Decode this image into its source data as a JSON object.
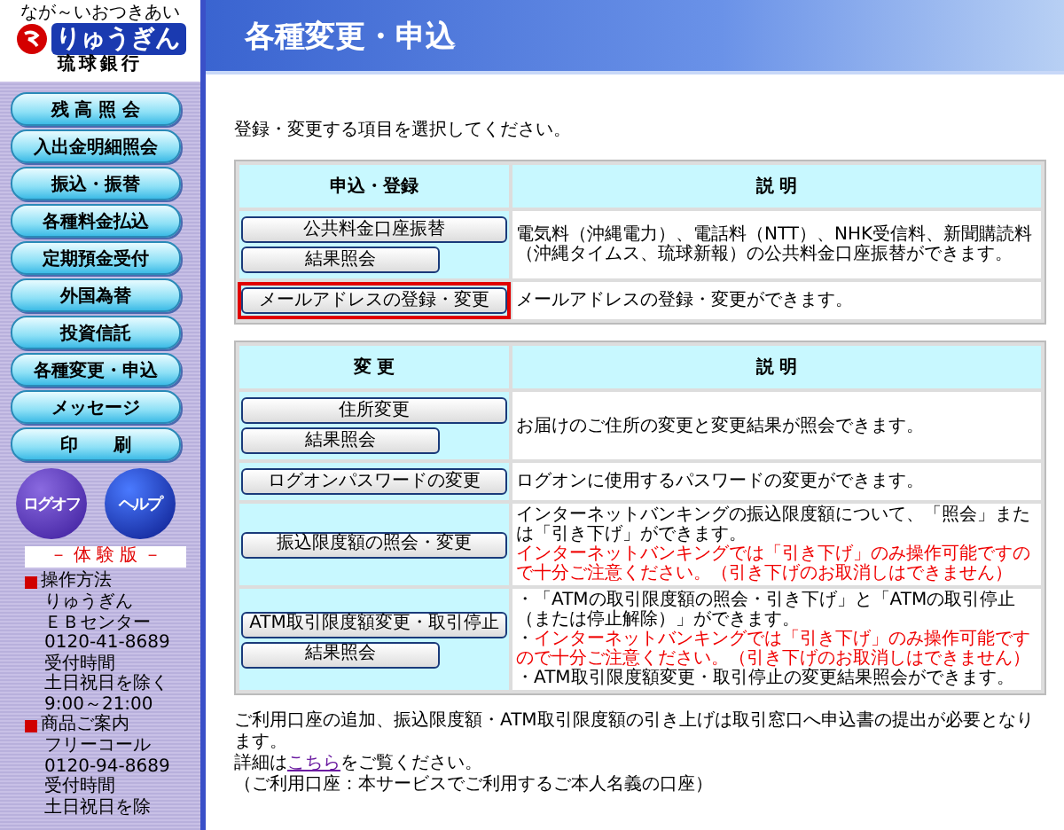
{
  "logo": {
    "tagline": "なが～いおつきあい",
    "brand": "りゅうぎん",
    "bank": "琉球銀行"
  },
  "menu": [
    "残 高 照 会",
    "入出金明細照会",
    "振込・振替",
    "各種料金払込",
    "定期預金受付",
    "外国為替",
    "投資信託",
    "各種変更・申込",
    "メッセージ",
    "印　　刷"
  ],
  "round_buttons": [
    {
      "label": "ログオフ",
      "kind": "logoff"
    },
    {
      "label": "ヘルプ",
      "kind": "help"
    }
  ],
  "trial_label": "－ 体 験 版 －",
  "info": [
    {
      "heading": "操作方法",
      "lines": [
        "りゅうぎん",
        "ＥＢセンター",
        "0120-41-8689",
        "受付時間",
        "土日祝日を除く",
        "9:00～21:00"
      ]
    },
    {
      "heading": "商品ご案内",
      "lines": [
        "フリーコール",
        "0120-94-8689",
        "受付時間",
        "土日祝日を除"
      ]
    }
  ],
  "header": {
    "title": "各種変更・申込"
  },
  "intro": "登録・変更する項目を選択してください。",
  "tables": [
    {
      "columns": [
        "申込・登録",
        "説 明"
      ],
      "rows": [
        {
          "buttons": [
            {
              "label": "公共料金口座振替",
              "highlighted": false
            },
            {
              "label": "結果照会",
              "highlighted": false
            }
          ],
          "lines": [
            [
              {
                "text": "電気料（沖縄電力）、電話料（NTT）、NHK受信料、新聞購読料（沖縄タイムス、琉球新報）の公共料金口座振替ができます。",
                "warning": false
              }
            ]
          ]
        },
        {
          "buttons": [
            {
              "label": "メールアドレスの登録・変更",
              "highlighted": true
            }
          ],
          "lines": [
            [
              {
                "text": "メールアドレスの登録・変更ができます。",
                "warning": false
              }
            ]
          ]
        }
      ]
    },
    {
      "columns": [
        "変 更",
        "説 明"
      ],
      "rows": [
        {
          "buttons": [
            {
              "label": "住所変更",
              "highlighted": false
            },
            {
              "label": "結果照会",
              "highlighted": false
            }
          ],
          "lines": [
            [
              {
                "text": "お届けのご住所の変更と変更結果が照会できます。",
                "warning": false
              }
            ]
          ]
        },
        {
          "buttons": [
            {
              "label": "ログオンパスワードの変更",
              "highlighted": false
            }
          ],
          "lines": [
            [
              {
                "text": "ログオンに使用するパスワードの変更ができます。",
                "warning": false
              }
            ]
          ]
        },
        {
          "buttons": [
            {
              "label": "振込限度額の照会・変更",
              "highlighted": false
            }
          ],
          "lines": [
            [
              {
                "text": "インターネットバンキングの振込限度額について、「照会」または「引き下げ」ができます。",
                "warning": false
              }
            ],
            [
              {
                "text": "インターネットバンキングでは「引き下げ」のみ操作可能ですので十分ご注意ください。（引き下げのお取消しはできません）",
                "warning": true
              }
            ]
          ]
        },
        {
          "buttons": [
            {
              "label": "ATM取引限度額変更・取引停止",
              "highlighted": false
            },
            {
              "label": "結果照会",
              "highlighted": false
            }
          ],
          "lines": [
            [
              {
                "text": "・「ATMの取引限度額の照会・引き下げ」と「ATMの取引停止（または停止解除）」ができます。",
                "warning": false
              }
            ],
            [
              {
                "text": "・",
                "warning": false
              },
              {
                "text": "インターネットバンキングでは「引き下げ」のみ操作可能ですので十分ご注意ください。（引き下げのお取消しはできません）",
                "warning": true
              }
            ],
            [
              {
                "text": "・ATM取引限度額変更・取引停止の変更結果照会ができます。",
                "warning": false
              }
            ]
          ]
        }
      ]
    }
  ],
  "footer": {
    "note": "ご利用口座の追加、振込限度額・ATM取引限度額の引き上げは取引窓口へ申込書の提出が必要となります。",
    "detail_before": "詳細は",
    "detail_link": "こちら",
    "detail_after": "をご覧ください。",
    "account_note": "（ご利用口座：本サービスでご利用するご本人名義の口座）"
  }
}
